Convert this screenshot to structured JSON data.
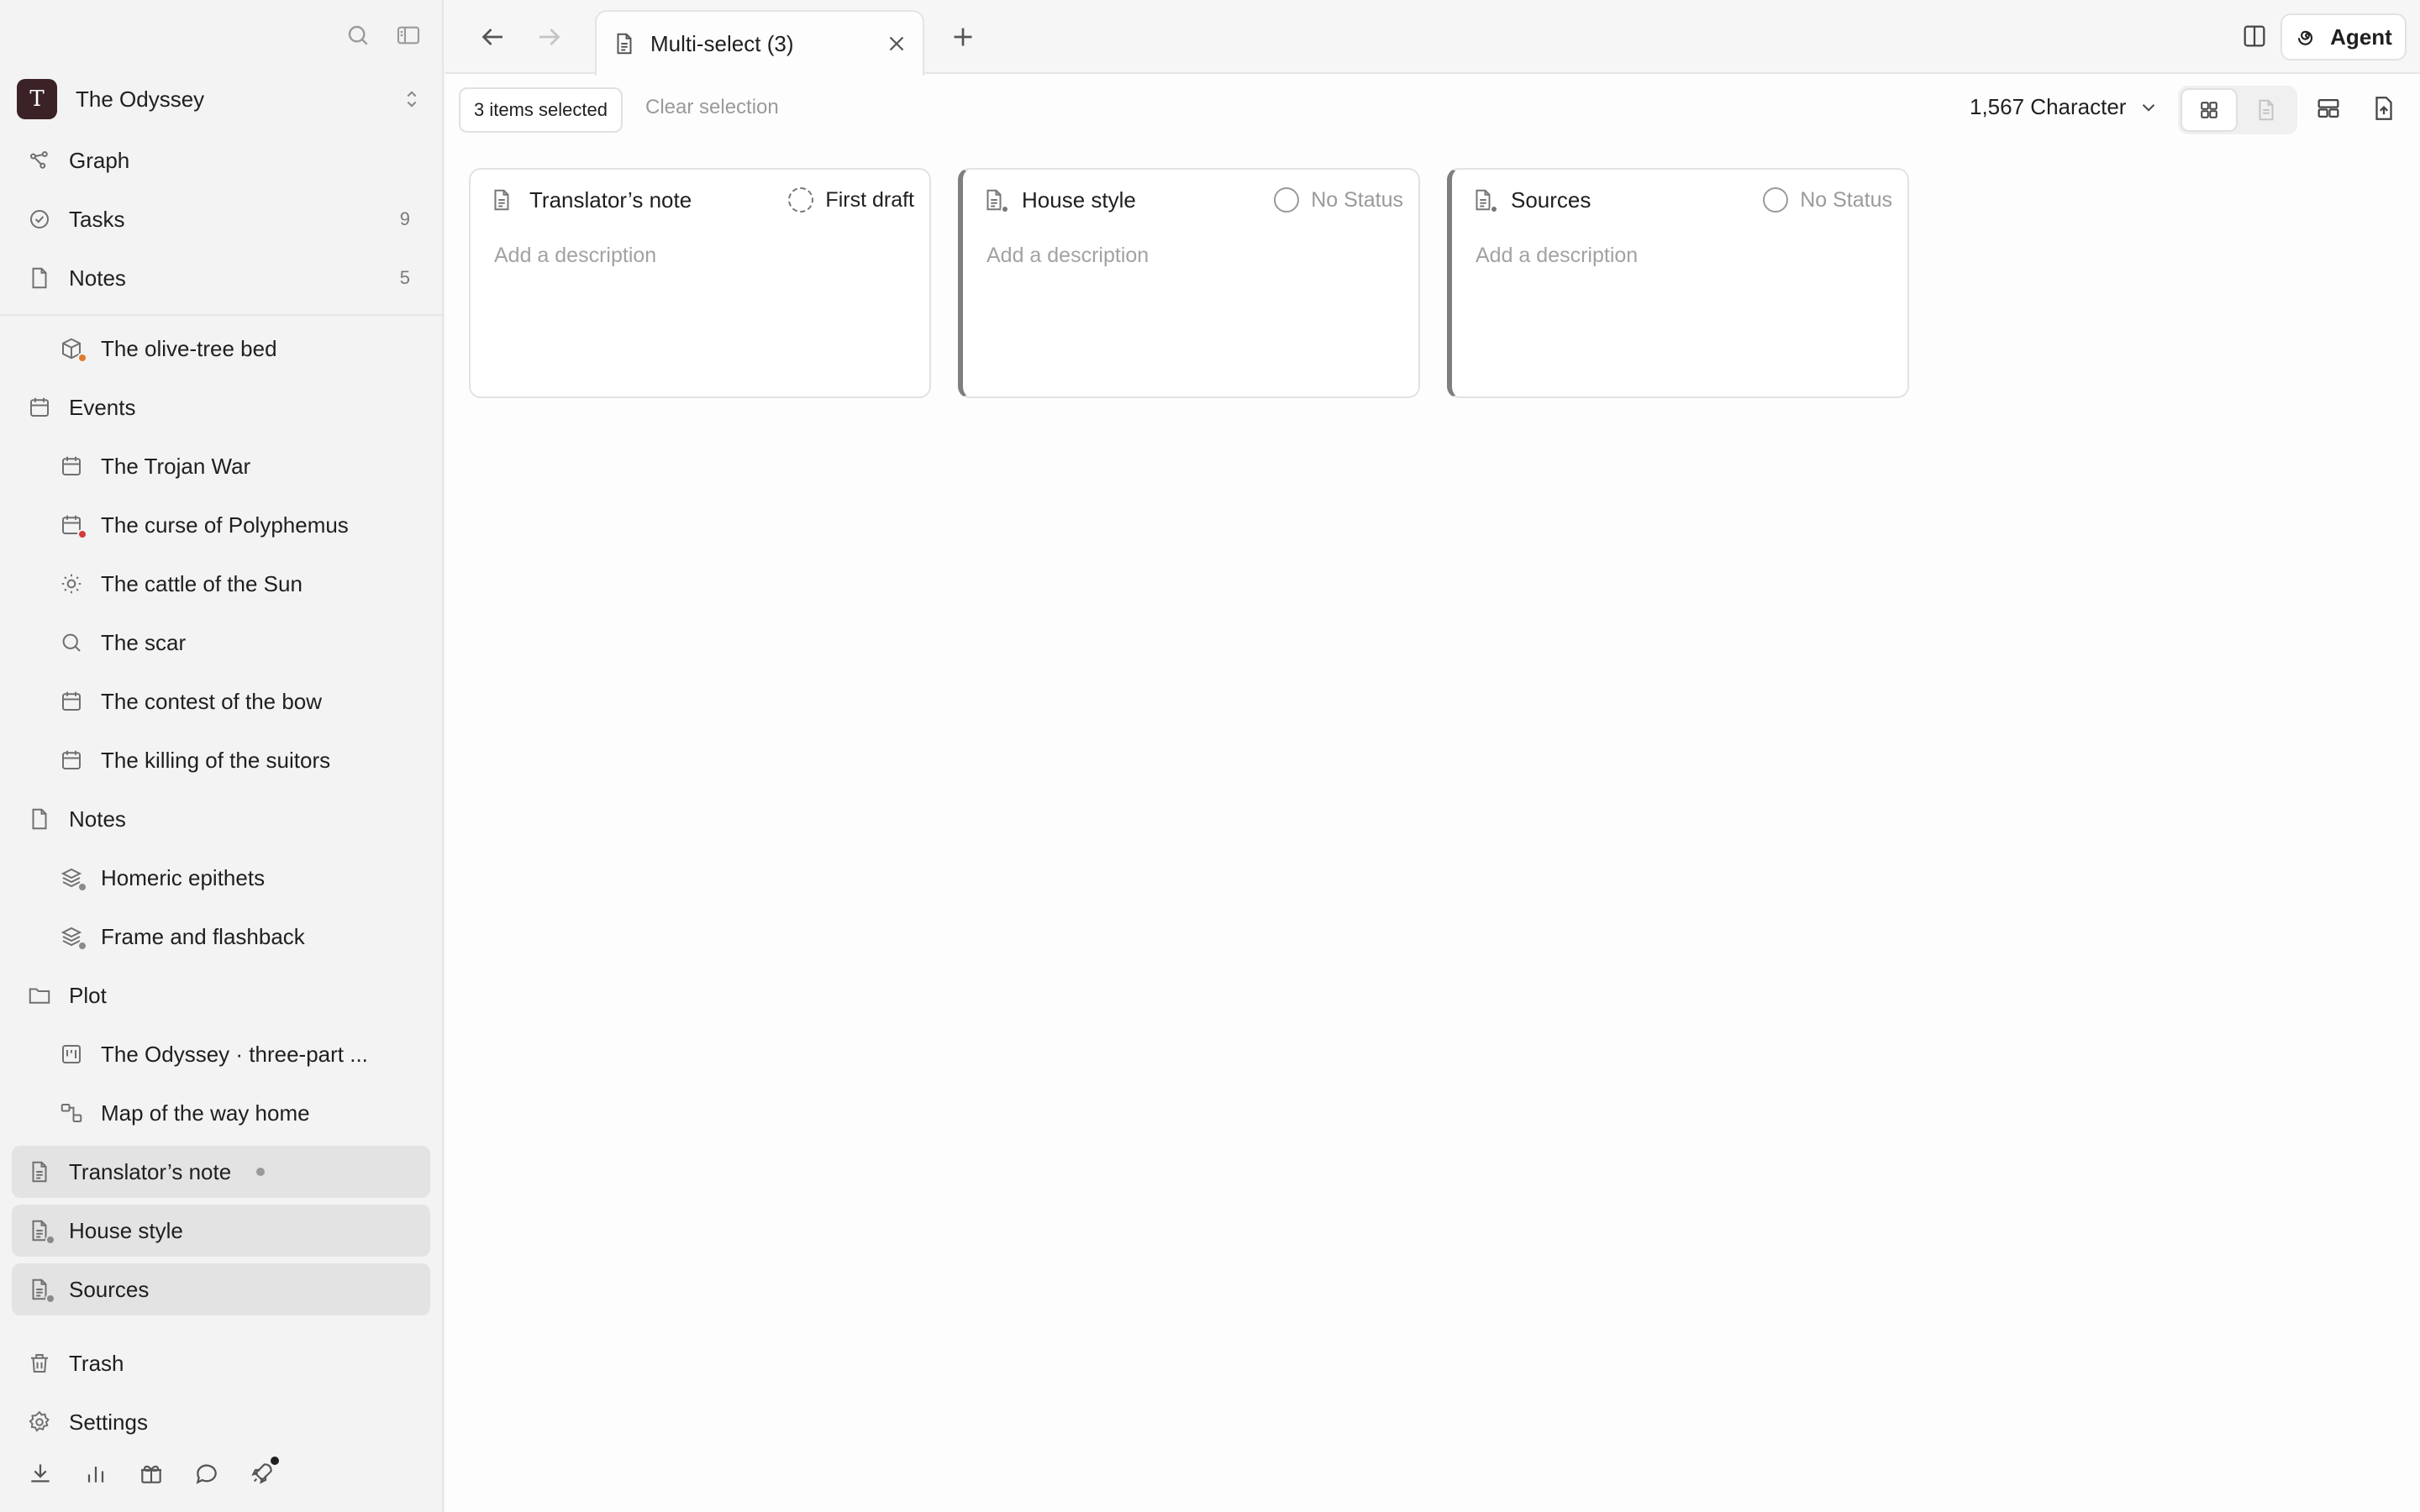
{
  "workspace": {
    "initial": "T",
    "name": "The Odyssey"
  },
  "sidebar": {
    "top": [
      {
        "label": "Graph",
        "icon": "graph-icon"
      },
      {
        "label": "Tasks",
        "icon": "task-check-icon",
        "count": "9"
      },
      {
        "label": "Notes",
        "icon": "note-icon",
        "count": "5"
      }
    ],
    "tree": [
      {
        "label": "The olive-tree bed",
        "icon": "cube-icon",
        "badge": "#e07b2e"
      },
      {
        "label": "Events",
        "icon": "calendar-icon",
        "top": true
      },
      {
        "label": "The Trojan War",
        "icon": "calendar-icon"
      },
      {
        "label": "The curse of Polyphemus",
        "icon": "calendar-icon",
        "badge": "#d23b3b"
      },
      {
        "label": "The cattle of the Sun",
        "icon": "sun-icon"
      },
      {
        "label": "The scar",
        "icon": "search-icon"
      },
      {
        "label": "The contest of the bow",
        "icon": "calendar-icon"
      },
      {
        "label": "The killing of the suitors",
        "icon": "calendar-icon"
      },
      {
        "label": "Notes",
        "icon": "note-icon",
        "top": true
      },
      {
        "label": "Homeric epithets",
        "icon": "layers-icon",
        "badge": "#8a8a8a"
      },
      {
        "label": "Frame and flashback",
        "icon": "layers-icon",
        "badge": "#8a8a8a"
      },
      {
        "label": "Plot",
        "icon": "folder-icon",
        "top": true
      },
      {
        "label": "The Odyssey · three-part ...",
        "icon": "board-icon"
      },
      {
        "label": "Map of the way home",
        "icon": "map-flow-icon"
      }
    ],
    "selected": [
      {
        "label": "Translator’s note",
        "icon": "document-icon"
      },
      {
        "label": "House style",
        "icon": "document-icon",
        "badge": "#8a8a8a"
      },
      {
        "label": "Sources",
        "icon": "document-icon",
        "badge": "#8a8a8a"
      }
    ],
    "trash": "Trash",
    "settings": "Settings"
  },
  "tab": {
    "title": "Multi-select (3)"
  },
  "agent": {
    "label": "Agent"
  },
  "toolbar": {
    "selected_label": "3 items selected",
    "clear_label": "Clear selection",
    "char_count": "1,567 Character"
  },
  "cards": [
    {
      "title": "Translator’s note",
      "status": "First draft",
      "status_kind": "set",
      "description": "Add a description"
    },
    {
      "title": "House style",
      "status": "No Status",
      "status_kind": "none",
      "description": "Add a description"
    },
    {
      "title": "Sources",
      "status": "No Status",
      "status_kind": "none",
      "description": "Add a description"
    }
  ],
  "colors": {
    "accent_avatar": "#3b2226",
    "selected_row": "#e3e3e3"
  }
}
